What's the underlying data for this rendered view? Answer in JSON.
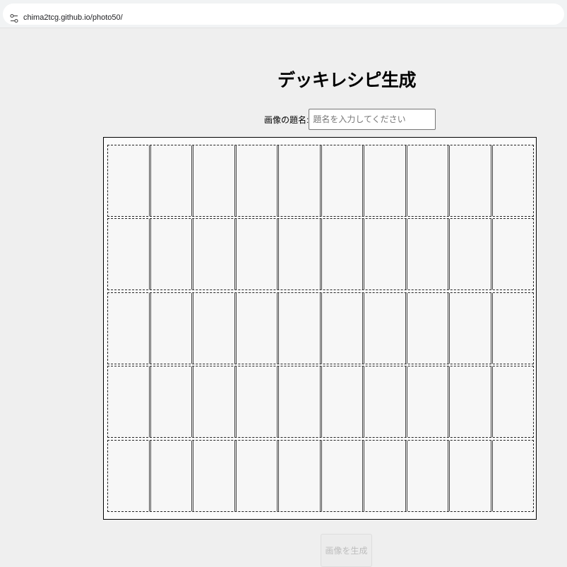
{
  "browser": {
    "url": "chima2tcg.github.io/photo50/"
  },
  "page": {
    "heading": "デッキレシピ生成",
    "title_label": "画像の題名:",
    "title_placeholder": "題名を入力してください",
    "title_value": "",
    "generate_button_label": "画像を生成"
  },
  "deck_grid": {
    "rows": 5,
    "slots_per_row": 10
  },
  "icons": {
    "site_info": "tune-icon"
  }
}
